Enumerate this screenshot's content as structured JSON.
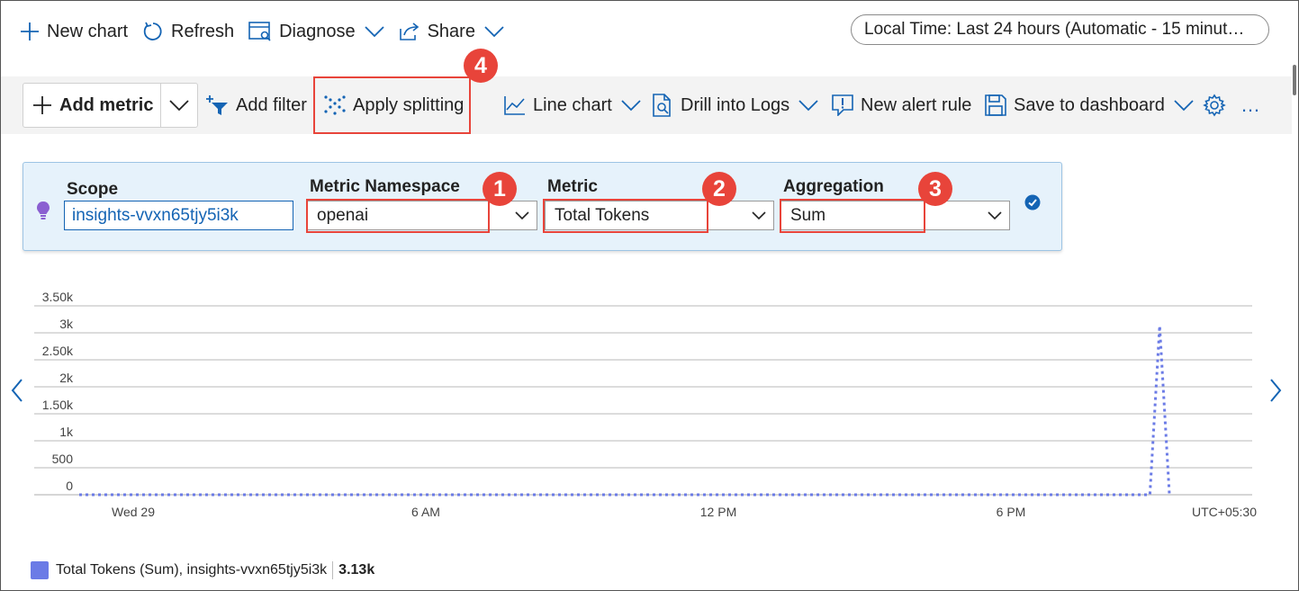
{
  "topbar": {
    "new_chart": "New chart",
    "refresh": "Refresh",
    "diagnose": "Diagnose",
    "share": "Share",
    "time_range": "Local Time: Last 24 hours (Automatic - 15 minut…"
  },
  "toolbar": {
    "add_metric": "Add metric",
    "add_filter": "Add filter",
    "apply_splitting": "Apply splitting",
    "line_chart": "Line chart",
    "drill_logs": "Drill into Logs",
    "new_alert": "New alert rule",
    "save_dashboard": "Save to dashboard",
    "more": "…"
  },
  "metric_row": {
    "scope_label": "Scope",
    "scope_value": "insights-vvxn65tjy5i3k",
    "namespace_label": "Metric Namespace",
    "namespace_value": "openai",
    "metric_label": "Metric",
    "metric_value": "Total Tokens",
    "aggregation_label": "Aggregation",
    "aggregation_value": "Sum"
  },
  "badges": [
    "1",
    "2",
    "3",
    "4"
  ],
  "chart_data": {
    "type": "line",
    "y_ticks": [
      "3.50k",
      "3k",
      "2.50k",
      "2k",
      "1.50k",
      "1k",
      "500",
      "0"
    ],
    "x_ticks": [
      "Wed 29",
      "6 AM",
      "12 PM",
      "6 PM"
    ],
    "timezone": "UTC+05:30",
    "ylim": [
      0,
      3500
    ],
    "grid": true,
    "series": [
      {
        "name": "Total Tokens (Sum), insights-vvxn65tjy5i3k",
        "color": "#6b7be6",
        "style": "dotted",
        "x_hours": [
          0,
          20.85,
          21.05,
          21.25
        ],
        "values": [
          0,
          0,
          3130,
          0
        ]
      }
    ]
  },
  "legend": {
    "label": "Total Tokens (Sum), insights-vvxn65tjy5i3k",
    "value": "3.13k"
  },
  "colors": {
    "accent": "#1464b4",
    "highlight": "#e8443a",
    "card_bg": "#e6f2fb",
    "series": "#6b7be6"
  }
}
